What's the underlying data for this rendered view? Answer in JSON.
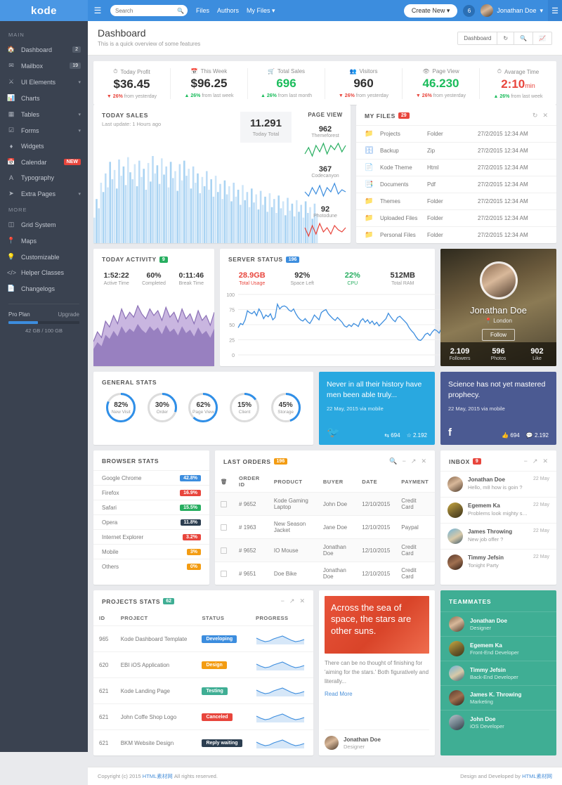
{
  "topbar": {
    "brand": "kode",
    "menu_icon": "hamburger-icon",
    "search_placeholder": "Search",
    "nav": [
      "Files",
      "Authors",
      "My Files"
    ],
    "create_new": "Create New",
    "notification_count": "6",
    "user_name": "Jonathan Doe"
  },
  "sidebar": {
    "sections": [
      {
        "label": "MAIN",
        "items": [
          {
            "label": "Dashboard",
            "icon": "home-icon",
            "badge": "2"
          },
          {
            "label": "Mailbox",
            "icon": "envelope-icon",
            "badge": "19"
          },
          {
            "label": "UI Elements",
            "icon": "flask-icon",
            "caret": true
          },
          {
            "label": "Charts",
            "icon": "bar-chart-icon"
          },
          {
            "label": "Tables",
            "icon": "grid-icon",
            "caret": true
          },
          {
            "label": "Forms",
            "icon": "checkbox-icon",
            "caret": true
          },
          {
            "label": "Widgets",
            "icon": "diamond-icon"
          },
          {
            "label": "Calendar",
            "icon": "calendar-icon",
            "badge": "NEW",
            "badge_new": true
          },
          {
            "label": "Typography",
            "icon": "font-icon"
          },
          {
            "label": "Extra Pages",
            "icon": "paper-plane-icon",
            "caret": true
          }
        ]
      },
      {
        "label": "MORE",
        "items": [
          {
            "label": "Grid System",
            "icon": "columns-icon"
          },
          {
            "label": "Maps",
            "icon": "map-pin-icon"
          },
          {
            "label": "Customizable",
            "icon": "lightbulb-icon"
          },
          {
            "label": "Helper Classes",
            "icon": "code-icon"
          },
          {
            "label": "Changelogs",
            "icon": "file-icon"
          }
        ]
      }
    ],
    "plan": {
      "name": "Pro Plan",
      "upgrade": "Upgrade",
      "percent": 42,
      "usage": "42 GB / 100 GB"
    }
  },
  "page": {
    "title": "Dashboard",
    "subtitle": "This is a quick overview of some features",
    "buttons": [
      "Dashboard",
      "refresh-icon",
      "search-icon",
      "chart-icon"
    ]
  },
  "stats": [
    {
      "title": "Today Profit",
      "icon": "clock-icon",
      "value": "$36.45",
      "value_color": "#2f2f2f",
      "delta": "26%",
      "delta_dir": "down",
      "delta_text": "from yesterday"
    },
    {
      "title": "This Week",
      "icon": "calendar-icon",
      "value": "$96.25",
      "value_color": "#2f2f2f",
      "delta": "26%",
      "delta_dir": "up",
      "delta_text": "from last week"
    },
    {
      "title": "Total Sales",
      "icon": "cart-icon",
      "value": "696",
      "value_color": "#1abc5b",
      "delta": "26%",
      "delta_dir": "up",
      "delta_text": "from last month"
    },
    {
      "title": "Visitors",
      "icon": "users-icon",
      "value": "960",
      "value_color": "#2f2f2f",
      "delta": "26%",
      "delta_dir": "down",
      "delta_text": "from yesterday"
    },
    {
      "title": "Page View",
      "icon": "eye-icon",
      "value": "46.230",
      "value_color": "#1abc5b",
      "delta": "26%",
      "delta_dir": "down",
      "delta_text": "from yesterday"
    },
    {
      "title": "Avarage Time",
      "icon": "clock-icon",
      "value": "2:10",
      "value_suffix": "min",
      "value_color": "#e8453c",
      "delta": "26%",
      "delta_dir": "up",
      "delta_text": "from last week"
    }
  ],
  "today_sales": {
    "title": "TODAY SALES",
    "subtitle": "Last update: 1 Hours ago",
    "total_value": "11.291",
    "total_label": "Today Total"
  },
  "page_view": {
    "title": "PAGE VIEW",
    "items": [
      {
        "value": "962",
        "label": "Themeforest",
        "color": "#27ae60"
      },
      {
        "value": "367",
        "label": "Codecanyon",
        "color": "#3c8dde"
      },
      {
        "value": "92",
        "label": "Photodune",
        "color": "#e8453c"
      }
    ]
  },
  "my_files": {
    "title": "MY FILES",
    "badge": "29",
    "badge_color": "#e8453c",
    "tools": [
      "refresh-icon",
      "close-icon"
    ],
    "rows": [
      {
        "icon": "folder-icon",
        "name": "Projects",
        "type": "Folder",
        "date": "27/2/2015 12:34 AM"
      },
      {
        "icon": "zip-file-icon",
        "name": "Backup",
        "type": "Zip",
        "date": "27/2/2015 12:34 AM"
      },
      {
        "icon": "html-file-icon",
        "name": "Kode Theme",
        "type": "Html",
        "date": "27/2/2015 12:34 AM"
      },
      {
        "icon": "pdf-file-icon",
        "name": "Documents",
        "type": "Pdf",
        "date": "27/2/2015 12:34 AM"
      },
      {
        "icon": "folder-icon",
        "name": "Themes",
        "type": "Folder",
        "date": "27/2/2015 12:34 AM"
      },
      {
        "icon": "folder-icon",
        "name": "Uploaded Files",
        "type": "Folder",
        "date": "27/2/2015 12:34 AM"
      },
      {
        "icon": "folder-icon",
        "name": "Personal Files",
        "type": "Folder",
        "date": "27/2/2015 12:34 AM"
      }
    ]
  },
  "today_activity": {
    "title": "TODAY ACTIVITY",
    "badge": "9",
    "badge_color": "#27ae60",
    "metrics": [
      {
        "value": "1:52:22",
        "label": "Active Time"
      },
      {
        "value": "60%",
        "label": "Completed"
      },
      {
        "value": "0:11:46",
        "label": "Break Time"
      }
    ]
  },
  "server_status": {
    "title": "SERVER STATUS",
    "badge": "196",
    "badge_color": "#3c8dde",
    "metrics": [
      {
        "value": "28.9GB",
        "label": "Total Usage",
        "color": "#e8453c"
      },
      {
        "value": "92%",
        "label": "Space Left",
        "color": "#333333"
      },
      {
        "value": "22%",
        "label": "CPU",
        "color": "#27ae60"
      },
      {
        "value": "512MB",
        "label": "Total RAM",
        "color": "#333333"
      }
    ]
  },
  "profile": {
    "name": "Jonathan Doe",
    "location": "London",
    "follow_label": "Follow",
    "stats": [
      {
        "value": "2.109",
        "label": "Followers"
      },
      {
        "value": "596",
        "label": "Photos"
      },
      {
        "value": "902",
        "label": "Like"
      }
    ]
  },
  "general_stats": {
    "title": "GENERAL STATS",
    "items": [
      {
        "percent": 82,
        "label": "New Visit"
      },
      {
        "percent": 30,
        "label": "Order"
      },
      {
        "percent": 62,
        "label": "Page View"
      },
      {
        "percent": 15,
        "label": "Client"
      },
      {
        "percent": 45,
        "label": "Storage"
      }
    ],
    "accent": "#2f8fe8"
  },
  "social": [
    {
      "network": "twitter",
      "logo": "twitter-icon",
      "color": "#29a8e0",
      "quote": "Never in all their history have men been able truly...",
      "meta": "22 May, 2015 via mobile",
      "c1_icon": "retweet-icon",
      "c1": "694",
      "c2_icon": "star-icon",
      "c2": "2.192"
    },
    {
      "network": "facebook",
      "logo": "facebook-icon",
      "color": "#4b5a92",
      "quote": "Science has not yet mastered prophecy.",
      "meta": "22 May, 2015 via mobile",
      "c1_icon": "thumbs-up-icon",
      "c1": "694",
      "c2_icon": "comment-icon",
      "c2": "2.192"
    }
  ],
  "browser_stats": {
    "title": "BROWSER STATS",
    "rows": [
      {
        "name": "Google Chrome",
        "value": "42.8%",
        "color": "#3c8dde"
      },
      {
        "name": "Firefox",
        "value": "16.9%",
        "color": "#e8453c"
      },
      {
        "name": "Safari",
        "value": "15.5%",
        "color": "#27ae60"
      },
      {
        "name": "Opera",
        "value": "11.8%",
        "color": "#2c3e50"
      },
      {
        "name": "Internet Explorer",
        "value": "3.2%",
        "color": "#e8453c"
      },
      {
        "name": "Mobile",
        "value": "3%",
        "color": "#f39c12"
      },
      {
        "name": "Others",
        "value": "0%",
        "color": "#f39c12"
      }
    ]
  },
  "last_orders": {
    "title": "LAST ORDERS",
    "badge": "196",
    "badge_color": "#f39c12",
    "tools": [
      "search-icon",
      "minimize-icon",
      "expand-icon",
      "close-icon"
    ],
    "columns": [
      "trash-icon",
      "ORDER ID",
      "PRODUCT",
      "BUYER",
      "DATE",
      "PAYMENT"
    ],
    "rows": [
      {
        "id": "# 9652",
        "product": "Kode Gaming Laptop",
        "buyer": "John Doe",
        "date": "12/10/2015",
        "payment": "Credit Card"
      },
      {
        "id": "# 1963",
        "product": "New Season Jacket",
        "buyer": "Jane Doe",
        "date": "12/10/2015",
        "payment": "Paypal"
      },
      {
        "id": "# 9652",
        "product": "IO Mouse",
        "buyer": "Jonathan Doe",
        "date": "12/10/2015",
        "payment": "Credit Card"
      },
      {
        "id": "# 9651",
        "product": "Doe Bike",
        "buyer": "Jonathan Doe",
        "date": "12/10/2015",
        "payment": "Credit Card"
      }
    ]
  },
  "inbox": {
    "title": "INBOX",
    "badge": "9",
    "badge_color": "#e8453c",
    "tools": [
      "minimize-icon",
      "expand-icon",
      "close-icon"
    ],
    "messages": [
      {
        "name": "Jonathan Doe",
        "preview": "Hello, m8 how is goin ?",
        "date": "22 May",
        "avatar": "avp1"
      },
      {
        "name": "Egemem Ka",
        "preview": "Problems look mighty small...",
        "date": "22 May",
        "avatar": "avp2"
      },
      {
        "name": "James Throwing",
        "preview": "New job offer ?",
        "date": "22 May",
        "avatar": "avp3"
      },
      {
        "name": "Timmy Jefsin",
        "preview": "Tonight Party",
        "date": "22 May",
        "avatar": "avp4"
      }
    ]
  },
  "projects_stats": {
    "title": "PROJECTS STATS",
    "badge": "62",
    "badge_color": "#3fae94",
    "tools": [
      "minimize-icon",
      "expand-icon",
      "close-icon"
    ],
    "columns": [
      "ID",
      "PROJECT",
      "STATUS",
      "PROGRESS"
    ],
    "rows": [
      {
        "id": "965",
        "project": "Kode Dashboard Template",
        "status": "Developing",
        "status_color": "#3c8dde"
      },
      {
        "id": "620",
        "project": "EBI iOS Application",
        "status": "Design",
        "status_color": "#f39c12"
      },
      {
        "id": "621",
        "project": "Kode Landing Page",
        "status": "Testing",
        "status_color": "#3fae94"
      },
      {
        "id": "621",
        "project": "John Coffe Shop Logo",
        "status": "Canceled",
        "status_color": "#e8453c"
      },
      {
        "id": "621",
        "project": "BKM Website Design",
        "status": "Reply waiting",
        "status_color": "#2c3e50"
      }
    ]
  },
  "quote_card": {
    "hero": "Across the sea of space, the stars are other suns.",
    "body": "There can be no thought of finishing for 'aiming for the stars.' Both figuratively and literally...",
    "read_more": "Read More",
    "author": "Jonathan Doe",
    "role": "Designer"
  },
  "teammates": {
    "title": "TEAMMATES",
    "members": [
      {
        "name": "Jonathan Doe",
        "role": "Designer",
        "avatar": "avp1"
      },
      {
        "name": "Egemem Ka",
        "role": "Front-End Developer",
        "avatar": "avp2"
      },
      {
        "name": "Timmy Jefsin",
        "role": "Back-End Developer",
        "avatar": "avp3"
      },
      {
        "name": "James K. Throwing",
        "role": "Marketing",
        "avatar": "avp4"
      },
      {
        "name": "John Doe",
        "role": "iOS Developer",
        "avatar": "avp5"
      }
    ]
  },
  "footer": {
    "left_prefix": "Copyright (c) 2015",
    "left_link": "HTML素材网",
    "left_suffix": "All rights reserved.",
    "right_prefix": "Design and Developed by",
    "right_link": "HTML素材网"
  },
  "chart_data": [
    {
      "type": "bar",
      "title": "TODAY SALES",
      "ylabel": "",
      "xlabel": "",
      "series": [
        {
          "name": "sales",
          "values": [
            22,
            38,
            30,
            52,
            44,
            60,
            48,
            70,
            55,
            63,
            47,
            72,
            58,
            66,
            50,
            74,
            61,
            55,
            68,
            49,
            71,
            57,
            64,
            46,
            69,
            53,
            75,
            60,
            67,
            51,
            73,
            59,
            66,
            48,
            70,
            56,
            62,
            45,
            68,
            54,
            71,
            58,
            64,
            47,
            66,
            52,
            60,
            43,
            57,
            49,
            62,
            46,
            55,
            40,
            58,
            44,
            51,
            38,
            54,
            42,
            49,
            36,
            52,
            40,
            46,
            33,
            50,
            37,
            44,
            31,
            47,
            35,
            42,
            29,
            45,
            33,
            40,
            27,
            43,
            31,
            38,
            26,
            41,
            30,
            36,
            24,
            39,
            28,
            34,
            23,
            37,
            27,
            33,
            22,
            36,
            26,
            31,
            21,
            34,
            25
          ]
        }
      ],
      "color": "#b9dcf5"
    },
    {
      "type": "line",
      "title": "Themeforest",
      "values": [
        4,
        7,
        3,
        8,
        5,
        9,
        4,
        8,
        6,
        9,
        5,
        8
      ],
      "color": "#27ae60",
      "annotation": "962"
    },
    {
      "type": "line",
      "title": "Codecanyon",
      "values": [
        5,
        3,
        7,
        4,
        8,
        3,
        7,
        5,
        9,
        4,
        6,
        5
      ],
      "color": "#3c8dde",
      "annotation": "367"
    },
    {
      "type": "line",
      "title": "Photodune",
      "values": [
        6,
        2,
        7,
        3,
        8,
        4,
        6,
        3,
        7,
        5,
        4,
        6
      ],
      "color": "#e8453c",
      "annotation": "92"
    },
    {
      "type": "area",
      "title": "TODAY ACTIVITY",
      "values": [
        30,
        42,
        35,
        55,
        48,
        62,
        52,
        70,
        58,
        66,
        60,
        74,
        64,
        58,
        70,
        62,
        68,
        56,
        72,
        60,
        66,
        54,
        70,
        58,
        64,
        52,
        68,
        56,
        62,
        50,
        66
      ],
      "color": "#9b84c4"
    },
    {
      "type": "line",
      "title": "SERVER STATUS",
      "ylim": [
        0,
        100
      ],
      "yticks": [
        0,
        25,
        50,
        75,
        100
      ],
      "grid": true,
      "values": [
        45,
        52,
        50,
        58,
        73,
        70,
        68,
        72,
        65,
        76,
        70,
        60,
        66,
        63,
        68,
        58,
        62,
        84,
        76,
        80,
        81,
        79,
        74,
        72,
        76,
        68,
        62,
        58,
        56,
        60,
        55,
        52,
        58,
        66,
        62,
        58,
        70,
        73,
        75,
        68,
        64,
        60,
        57,
        62,
        58,
        54,
        48,
        46,
        50,
        47,
        52,
        50,
        47,
        56,
        60,
        54,
        58,
        52,
        56,
        50,
        54,
        48,
        52,
        56,
        60,
        69,
        63,
        58,
        55,
        62,
        64,
        60,
        56,
        52,
        45,
        40,
        36,
        30,
        25,
        24,
        28,
        34,
        36,
        32,
        38,
        42,
        40,
        36,
        44,
        40,
        37
      ],
      "color": "#3c8dde"
    }
  ]
}
